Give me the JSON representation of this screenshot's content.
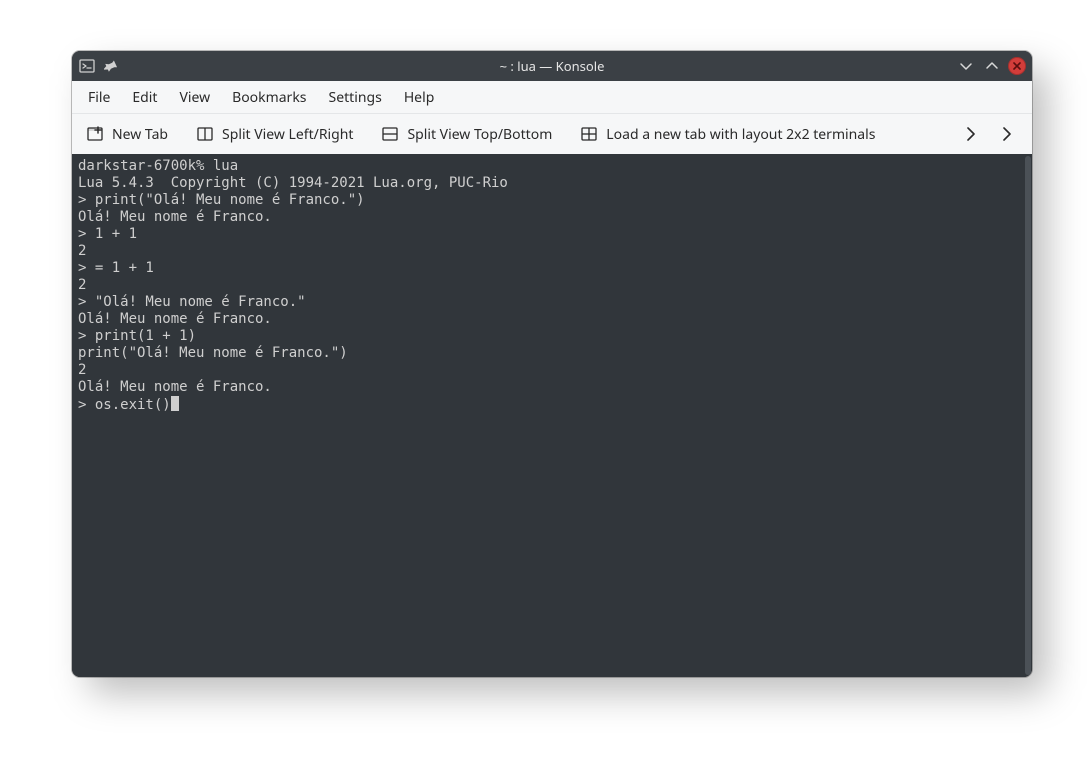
{
  "window": {
    "title": "~ : lua — Konsole"
  },
  "menubar": {
    "items": [
      "File",
      "Edit",
      "View",
      "Bookmarks",
      "Settings",
      "Help"
    ]
  },
  "toolbar": {
    "new_tab": "New Tab",
    "split_lr": "Split View Left/Right",
    "split_tb": "Split View Top/Bottom",
    "load_layout": "Load a new tab with layout 2x2 terminals"
  },
  "terminal": {
    "shell_prompt": "darkstar-6700k% ",
    "shell_cmd": "lua",
    "banner": "Lua 5.4.3  Copyright (C) 1994-2021 Lua.org, PUC-Rio",
    "lua_prompt": "> ",
    "lines": [
      {
        "type": "shell",
        "cmd": "lua"
      },
      {
        "type": "out",
        "text": "Lua 5.4.3  Copyright (C) 1994-2021 Lua.org, PUC-Rio"
      },
      {
        "type": "in",
        "text": "print(\"Olá! Meu nome é Franco.\")"
      },
      {
        "type": "out",
        "text": "Olá! Meu nome é Franco."
      },
      {
        "type": "in",
        "text": "1 + 1"
      },
      {
        "type": "out",
        "text": "2"
      },
      {
        "type": "in",
        "text": "= 1 + 1"
      },
      {
        "type": "out",
        "text": "2"
      },
      {
        "type": "in",
        "text": "\"Olá! Meu nome é Franco.\""
      },
      {
        "type": "out",
        "text": "Olá! Meu nome é Franco."
      },
      {
        "type": "in",
        "text": "print(1 + 1)"
      },
      {
        "type": "out",
        "text": "print(\"Olá! Meu nome é Franco.\")"
      },
      {
        "type": "out",
        "text": "2"
      },
      {
        "type": "out",
        "text": "Olá! Meu nome é Franco."
      },
      {
        "type": "in",
        "text": "os.exit()",
        "cursor": true
      }
    ]
  }
}
